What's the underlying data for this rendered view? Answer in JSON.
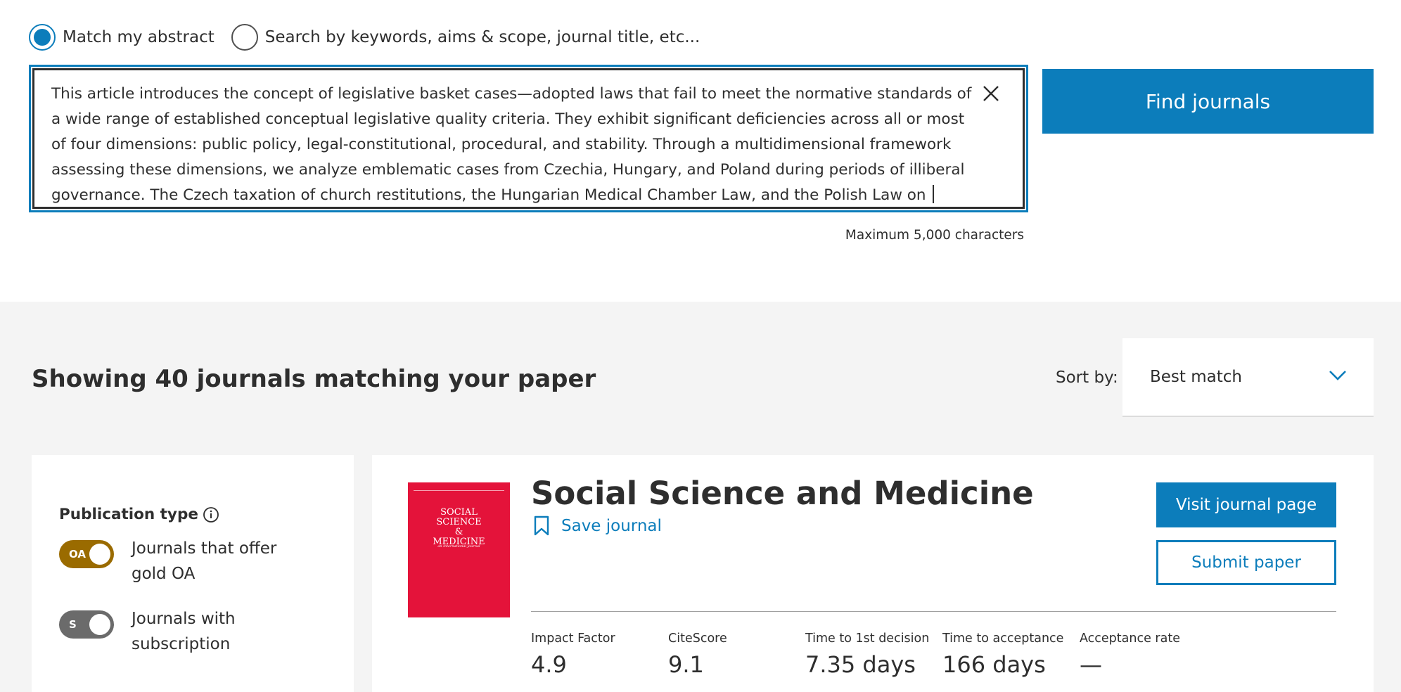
{
  "search": {
    "mode_abstract_label": "Match my abstract",
    "mode_keywords_label": "Search by keywords, aims & scope, journal title, etc...",
    "abstract_text": "This article introduces the concept of legislative basket cases—adopted laws that fail to meet the normative standards of\na wide range of established conceptual legislative quality criteria. They exhibit significant deficiencies across all or most\nof four dimensions: public policy, legal-constitutional, procedural, and stability. Through a multidimensional framework\nassessing these dimensions, we analyze emblematic cases from Czechia, Hungary, and Poland during periods of illiberal\ngovernance. The Czech taxation of church restitutions, the Hungarian Medical Chamber Law, and the Polish Law on ",
    "max_chars_note": "Maximum 5,000 characters",
    "find_button": "Find journals",
    "selected_mode": "Match my abstract"
  },
  "results": {
    "title": "Showing 40 journals matching your paper",
    "sort_label": "Sort by:",
    "sort_value": "Best match"
  },
  "filters": {
    "publication_type_title": "Publication type",
    "options": [
      {
        "badge": "OA",
        "label": "Journals that offer gold OA"
      },
      {
        "badge": "S",
        "label": "Journals with subscription"
      }
    ]
  },
  "journal": {
    "name": "Social Science and Medicine",
    "cover_title": "SOCIAL SCIENCE & MEDICINE",
    "cover_subtitle": "an international journal",
    "save_label": "Save journal",
    "visit_label": "Visit journal page",
    "submit_label": "Submit paper",
    "metrics": [
      {
        "label": "Impact Factor",
        "value": "4.9"
      },
      {
        "label": "CiteScore",
        "value": "9.1"
      },
      {
        "label": "Time to 1st decision",
        "value": "7.35 days"
      },
      {
        "label": "Time to acceptance",
        "value": "166 days"
      },
      {
        "label": "Acceptance rate",
        "value": "—"
      }
    ]
  },
  "colors": {
    "accent": "#0c7dbb",
    "oa_badge": "#9a6b00",
    "subscription_badge": "#6b6b6b",
    "cover": "#e4133a",
    "results_bg": "#f4f4f4"
  },
  "icons": [
    "close-icon",
    "chevron-down-icon",
    "info-icon",
    "bookmark-icon"
  ]
}
